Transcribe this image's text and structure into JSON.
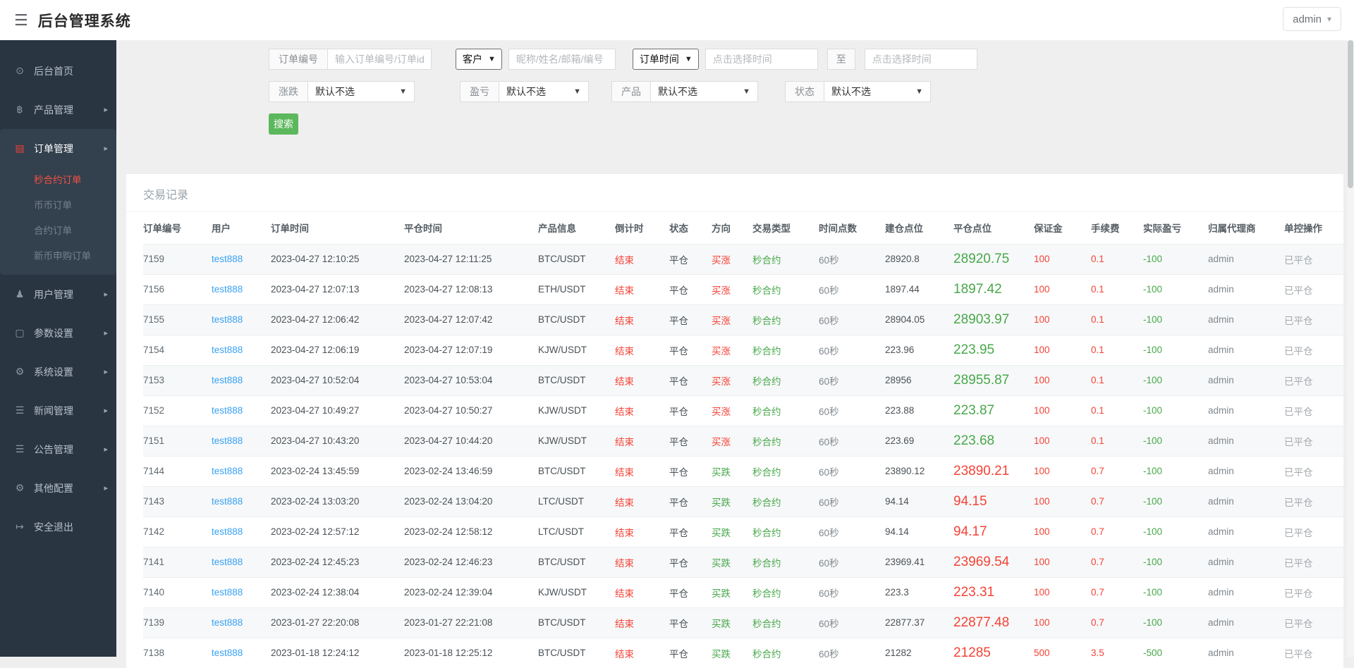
{
  "theme": {
    "red": "#f44336",
    "green": "#47a84a",
    "link": "#3aa2f3",
    "btn-green": "#5cb85c",
    "sidebar-bg": "#2a3542",
    "sidebar-panel": "#33404e",
    "active-red": "#f55145",
    "page-bg": "#efefef"
  },
  "header": {
    "title": "后台管理系统",
    "user": "admin"
  },
  "sidebar": {
    "items": [
      {
        "label": "后台首页",
        "icon": "dashboard-icon"
      },
      {
        "label": "产品管理",
        "icon": "bitcoin-icon",
        "arrow": true
      },
      {
        "label": "订单管理",
        "icon": "order-file-icon",
        "arrow": true,
        "expanded": true,
        "active": true,
        "children": [
          {
            "label": "秒合约订单",
            "active": true
          },
          {
            "label": "币币订单"
          },
          {
            "label": "合约订单"
          },
          {
            "label": "新币申购订单"
          }
        ]
      },
      {
        "label": "用户管理",
        "icon": "user-icon",
        "arrow": true
      },
      {
        "label": "参数设置",
        "icon": "document-icon",
        "arrow": true
      },
      {
        "label": "系统设置",
        "icon": "gears-icon",
        "arrow": true
      },
      {
        "label": "新闻管理",
        "icon": "news-list-icon",
        "arrow": true
      },
      {
        "label": "公告管理",
        "icon": "notice-list-icon",
        "arrow": true
      },
      {
        "label": "其他配置",
        "icon": "gear-icon",
        "arrow": true
      },
      {
        "label": "安全退出",
        "icon": "logout-icon"
      }
    ]
  },
  "filters": {
    "order_no": {
      "label": "订单编号",
      "placeholder": "输入订单编号/订单id"
    },
    "customer": {
      "select": "客户",
      "placeholder": "昵称/姓名/邮箱/编号"
    },
    "time": {
      "select": "订单时间",
      "placeholder_from": "点击选择时间",
      "to_label": "至",
      "placeholder_to": "点击选择时间"
    },
    "updown": {
      "label": "涨跌",
      "value": "默认不选"
    },
    "profit": {
      "label": "盈亏",
      "value": "默认不选"
    },
    "product": {
      "label": "产品",
      "value": "默认不选"
    },
    "status": {
      "label": "状态",
      "value": "默认不选"
    },
    "search_label": "搜索"
  },
  "table": {
    "title": "交易记录",
    "columns": [
      "订单编号",
      "用户",
      "订单时间",
      "平仓时间",
      "产品信息",
      "倒计时",
      "状态",
      "方向",
      "交易类型",
      "时间点数",
      "建仓点位",
      "平仓点位",
      "保证金",
      "手续费",
      "实际盈亏",
      "归属代理商",
      "单控操作"
    ],
    "rows": [
      {
        "id": "7159",
        "user": "test888",
        "open_time": "2023-04-27 12:10:25",
        "close_time": "2023-04-27 12:11:25",
        "product": "BTC/USDT",
        "countdown": "结束",
        "status": "平仓",
        "direction": "买涨",
        "direction_color": "red",
        "trade_type": "秒合约",
        "period": "60秒",
        "open_price": "28920.8",
        "close_price": "28920.75",
        "close_color": "green",
        "margin": "100",
        "fee": "0.1",
        "profit": "-100",
        "agent": "admin",
        "control": "已平仓"
      },
      {
        "id": "7156",
        "user": "test888",
        "open_time": "2023-04-27 12:07:13",
        "close_time": "2023-04-27 12:08:13",
        "product": "ETH/USDT",
        "countdown": "结束",
        "status": "平仓",
        "direction": "买涨",
        "direction_color": "red",
        "trade_type": "秒合约",
        "period": "60秒",
        "open_price": "1897.44",
        "close_price": "1897.42",
        "close_color": "green",
        "margin": "100",
        "fee": "0.1",
        "profit": "-100",
        "agent": "admin",
        "control": "已平仓"
      },
      {
        "id": "7155",
        "user": "test888",
        "open_time": "2023-04-27 12:06:42",
        "close_time": "2023-04-27 12:07:42",
        "product": "BTC/USDT",
        "countdown": "结束",
        "status": "平仓",
        "direction": "买涨",
        "direction_color": "red",
        "trade_type": "秒合约",
        "period": "60秒",
        "open_price": "28904.05",
        "close_price": "28903.97",
        "close_color": "green",
        "margin": "100",
        "fee": "0.1",
        "profit": "-100",
        "agent": "admin",
        "control": "已平仓"
      },
      {
        "id": "7154",
        "user": "test888",
        "open_time": "2023-04-27 12:06:19",
        "close_time": "2023-04-27 12:07:19",
        "product": "KJW/USDT",
        "countdown": "结束",
        "status": "平仓",
        "direction": "买涨",
        "direction_color": "red",
        "trade_type": "秒合约",
        "period": "60秒",
        "open_price": "223.96",
        "close_price": "223.95",
        "close_color": "green",
        "margin": "100",
        "fee": "0.1",
        "profit": "-100",
        "agent": "admin",
        "control": "已平仓"
      },
      {
        "id": "7153",
        "user": "test888",
        "open_time": "2023-04-27 10:52:04",
        "close_time": "2023-04-27 10:53:04",
        "product": "BTC/USDT",
        "countdown": "结束",
        "status": "平仓",
        "direction": "买涨",
        "direction_color": "red",
        "trade_type": "秒合约",
        "period": "60秒",
        "open_price": "28956",
        "close_price": "28955.87",
        "close_color": "green",
        "margin": "100",
        "fee": "0.1",
        "profit": "-100",
        "agent": "admin",
        "control": "已平仓"
      },
      {
        "id": "7152",
        "user": "test888",
        "open_time": "2023-04-27 10:49:27",
        "close_time": "2023-04-27 10:50:27",
        "product": "KJW/USDT",
        "countdown": "结束",
        "status": "平仓",
        "direction": "买涨",
        "direction_color": "red",
        "trade_type": "秒合约",
        "period": "60秒",
        "open_price": "223.88",
        "close_price": "223.87",
        "close_color": "green",
        "margin": "100",
        "fee": "0.1",
        "profit": "-100",
        "agent": "admin",
        "control": "已平仓"
      },
      {
        "id": "7151",
        "user": "test888",
        "open_time": "2023-04-27 10:43:20",
        "close_time": "2023-04-27 10:44:20",
        "product": "KJW/USDT",
        "countdown": "结束",
        "status": "平仓",
        "direction": "买涨",
        "direction_color": "red",
        "trade_type": "秒合约",
        "period": "60秒",
        "open_price": "223.69",
        "close_price": "223.68",
        "close_color": "green",
        "margin": "100",
        "fee": "0.1",
        "profit": "-100",
        "agent": "admin",
        "control": "已平仓"
      },
      {
        "id": "7144",
        "user": "test888",
        "open_time": "2023-02-24 13:45:59",
        "close_time": "2023-02-24 13:46:59",
        "product": "BTC/USDT",
        "countdown": "结束",
        "status": "平仓",
        "direction": "买跌",
        "direction_color": "green",
        "trade_type": "秒合约",
        "period": "60秒",
        "open_price": "23890.12",
        "close_price": "23890.21",
        "close_color": "red",
        "margin": "100",
        "fee": "0.7",
        "profit": "-100",
        "agent": "admin",
        "control": "已平仓"
      },
      {
        "id": "7143",
        "user": "test888",
        "open_time": "2023-02-24 13:03:20",
        "close_time": "2023-02-24 13:04:20",
        "product": "LTC/USDT",
        "countdown": "结束",
        "status": "平仓",
        "direction": "买跌",
        "direction_color": "green",
        "trade_type": "秒合约",
        "period": "60秒",
        "open_price": "94.14",
        "close_price": "94.15",
        "close_color": "red",
        "margin": "100",
        "fee": "0.7",
        "profit": "-100",
        "agent": "admin",
        "control": "已平仓"
      },
      {
        "id": "7142",
        "user": "test888",
        "open_time": "2023-02-24 12:57:12",
        "close_time": "2023-02-24 12:58:12",
        "product": "LTC/USDT",
        "countdown": "结束",
        "status": "平仓",
        "direction": "买跌",
        "direction_color": "green",
        "trade_type": "秒合约",
        "period": "60秒",
        "open_price": "94.14",
        "close_price": "94.17",
        "close_color": "red",
        "margin": "100",
        "fee": "0.7",
        "profit": "-100",
        "agent": "admin",
        "control": "已平仓"
      },
      {
        "id": "7141",
        "user": "test888",
        "open_time": "2023-02-24 12:45:23",
        "close_time": "2023-02-24 12:46:23",
        "product": "BTC/USDT",
        "countdown": "结束",
        "status": "平仓",
        "direction": "买跌",
        "direction_color": "green",
        "trade_type": "秒合约",
        "period": "60秒",
        "open_price": "23969.41",
        "close_price": "23969.54",
        "close_color": "red",
        "margin": "100",
        "fee": "0.7",
        "profit": "-100",
        "agent": "admin",
        "control": "已平仓"
      },
      {
        "id": "7140",
        "user": "test888",
        "open_time": "2023-02-24 12:38:04",
        "close_time": "2023-02-24 12:39:04",
        "product": "KJW/USDT",
        "countdown": "结束",
        "status": "平仓",
        "direction": "买跌",
        "direction_color": "green",
        "trade_type": "秒合约",
        "period": "60秒",
        "open_price": "223.3",
        "close_price": "223.31",
        "close_color": "red",
        "margin": "100",
        "fee": "0.7",
        "profit": "-100",
        "agent": "admin",
        "control": "已平仓"
      },
      {
        "id": "7139",
        "user": "test888",
        "open_time": "2023-01-27 22:20:08",
        "close_time": "2023-01-27 22:21:08",
        "product": "BTC/USDT",
        "countdown": "结束",
        "status": "平仓",
        "direction": "买跌",
        "direction_color": "green",
        "trade_type": "秒合约",
        "period": "60秒",
        "open_price": "22877.37",
        "close_price": "22877.48",
        "close_color": "red",
        "margin": "100",
        "fee": "0.7",
        "profit": "-100",
        "agent": "admin",
        "control": "已平仓"
      },
      {
        "id": "7138",
        "user": "test888",
        "open_time": "2023-01-18 12:24:12",
        "close_time": "2023-01-18 12:25:12",
        "product": "BTC/USDT",
        "countdown": "结束",
        "status": "平仓",
        "direction": "买跌",
        "direction_color": "green",
        "trade_type": "秒合约",
        "period": "60秒",
        "open_price": "21282",
        "close_price": "21285",
        "close_color": "red",
        "margin": "500",
        "fee": "3.5",
        "profit": "-500",
        "agent": "admin",
        "control": "已平仓"
      }
    ]
  }
}
